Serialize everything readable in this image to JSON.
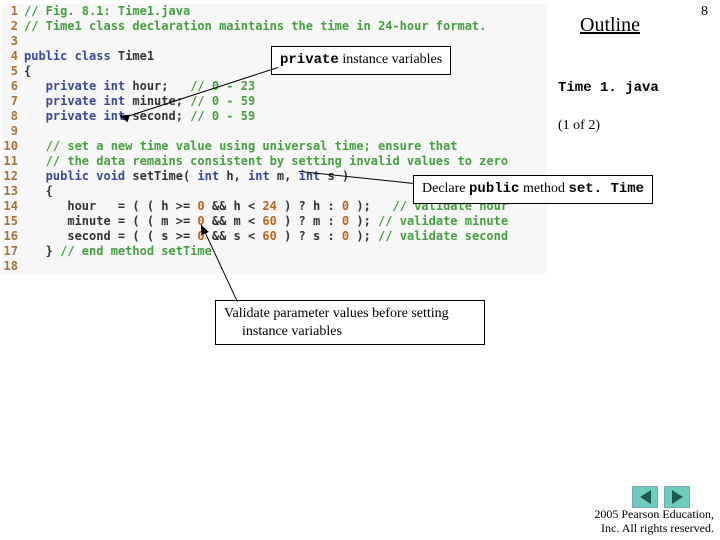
{
  "page_number": "8",
  "outline_label": "Outline",
  "file_label": "Time 1. java",
  "page_of": "(1 of 2)",
  "code": {
    "l1": "// Fig. 8.1: Time1.java",
    "l2": "// Time1 class declaration maintains the time in 24-hour format.",
    "l4a": "public class",
    "l4b": " Time1",
    "l5": "{",
    "l6a": "   private int",
    "l6b": " hour;   ",
    "l6c": "// 0 - 23",
    "l7a": "   private int",
    "l7b": " minute; ",
    "l7c": "// 0 - 59",
    "l8a": "   private int",
    "l8b": " second; ",
    "l8c": "// 0 - 59",
    "l10": "   // set a new time value using universal time; ensure that",
    "l11": "   // the data remains consistent by setting invalid values to zero",
    "l12a": "   public void",
    "l12b": " setTime( ",
    "l12c": "int",
    "l12d": " h, ",
    "l12e": "int",
    "l12f": " m, ",
    "l12g": "int",
    "l12h": " s )",
    "l13": "   {",
    "l14a": "      hour   = ( ( h >= ",
    "l14b": "0",
    "l14c": " && h < ",
    "l14d": "24",
    "l14e": " ) ? h : ",
    "l14f": "0",
    "l14g": " );   ",
    "l14h": "// validate hour",
    "l15a": "      minute = ( ( m >= ",
    "l15b": "0",
    "l15c": " && m < ",
    "l15d": "60",
    "l15e": " ) ? m : ",
    "l15f": "0",
    "l15g": " ); ",
    "l15h": "// validate minute",
    "l16a": "      second = ( ( s >= ",
    "l16b": "0",
    "l16c": " && s < ",
    "l16d": "60",
    "l16e": " ) ? s : ",
    "l16f": "0",
    "l16g": " ); ",
    "l16h": "// validate second",
    "l17a": "   } ",
    "l17b": "// end method setTime"
  },
  "callouts": {
    "c1_kw": "private",
    "c1_rest": " instance variables",
    "c2_pre": "Declare ",
    "c2_kw1": "public",
    "c2_mid": " method ",
    "c2_kw2": "set. Time",
    "c3_l1": "Validate parameter values before setting",
    "c3_l2": "instance variables"
  },
  "copyright": {
    "l1": "  2005 Pearson Education,",
    "l2": "Inc.  All rights reserved."
  },
  "line_numbers": [
    "1",
    "2",
    "3",
    "4",
    "5",
    "6",
    "7",
    "8",
    "9",
    "10",
    "11",
    "12",
    "13",
    "14",
    "15",
    "16",
    "17",
    "18"
  ]
}
